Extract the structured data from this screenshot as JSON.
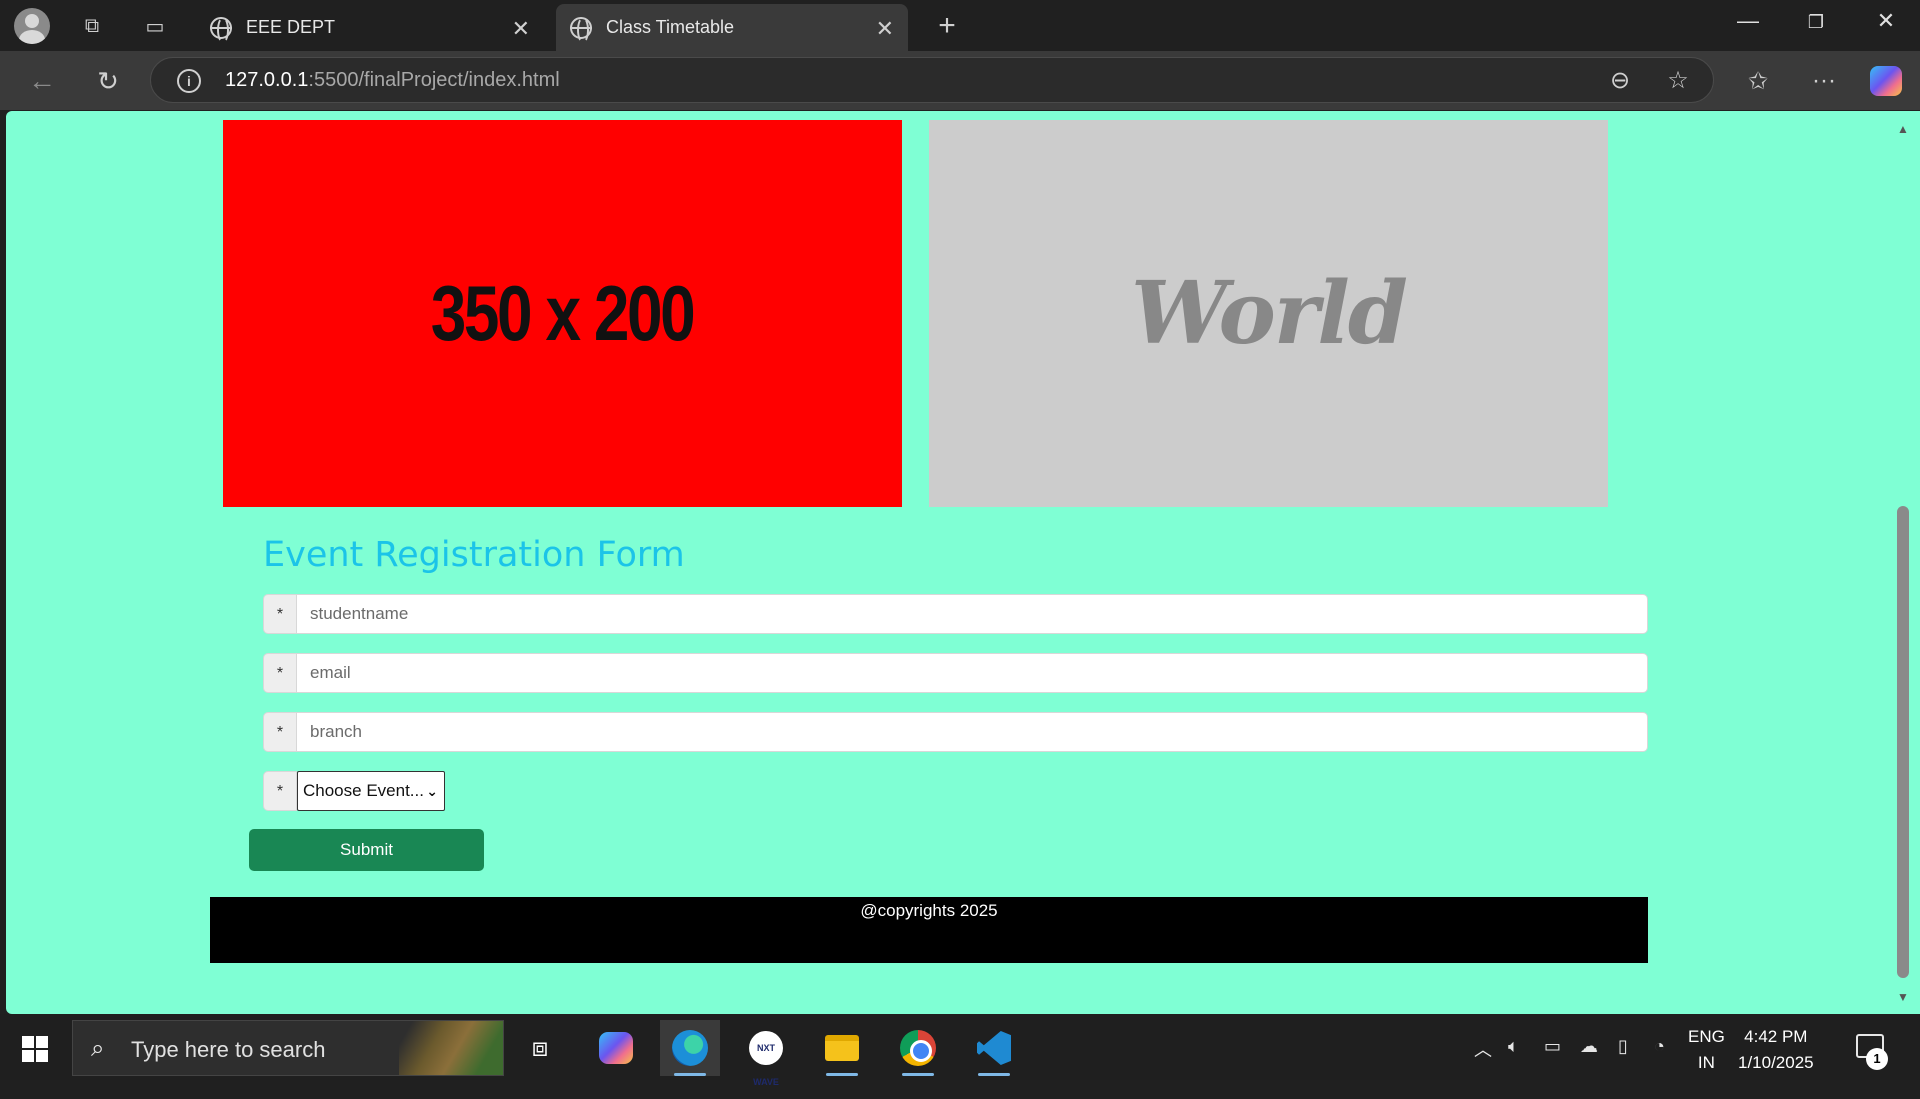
{
  "browser": {
    "tabs": [
      {
        "title": "EEE DEPT",
        "active": false
      },
      {
        "title": "Class Timetable",
        "active": true
      }
    ],
    "url_host": "127.0.0.1",
    "url_path": ":5500/finalProject/index.html"
  },
  "page": {
    "images": {
      "red_placeholder_text": "350 x 200",
      "grey_placeholder_text": "World"
    },
    "form": {
      "title": "Event Registration Form",
      "required_marker": "*",
      "fields": [
        {
          "placeholder": "studentname",
          "value": ""
        },
        {
          "placeholder": "email",
          "value": ""
        },
        {
          "placeholder": "branch",
          "value": ""
        }
      ],
      "event_select": {
        "selected": "Choose Event..."
      },
      "submit_label": "Submit"
    },
    "footer_text": "@copyrights 2025",
    "colors": {
      "background": "#7fffd4",
      "title": "#1bc4e8",
      "submit": "#198754",
      "footer": "#000000"
    }
  },
  "taskbar": {
    "search_placeholder": "Type here to search",
    "apps": [
      "task-view",
      "copilot",
      "edge",
      "nxtwave",
      "file-explorer",
      "chrome",
      "vscode"
    ],
    "nxtwave_label": "NXT WAVE",
    "lang_line1": "ENG",
    "lang_line2": "IN",
    "time": "4:42 PM",
    "date": "1/10/2025",
    "notification_count": "1"
  }
}
